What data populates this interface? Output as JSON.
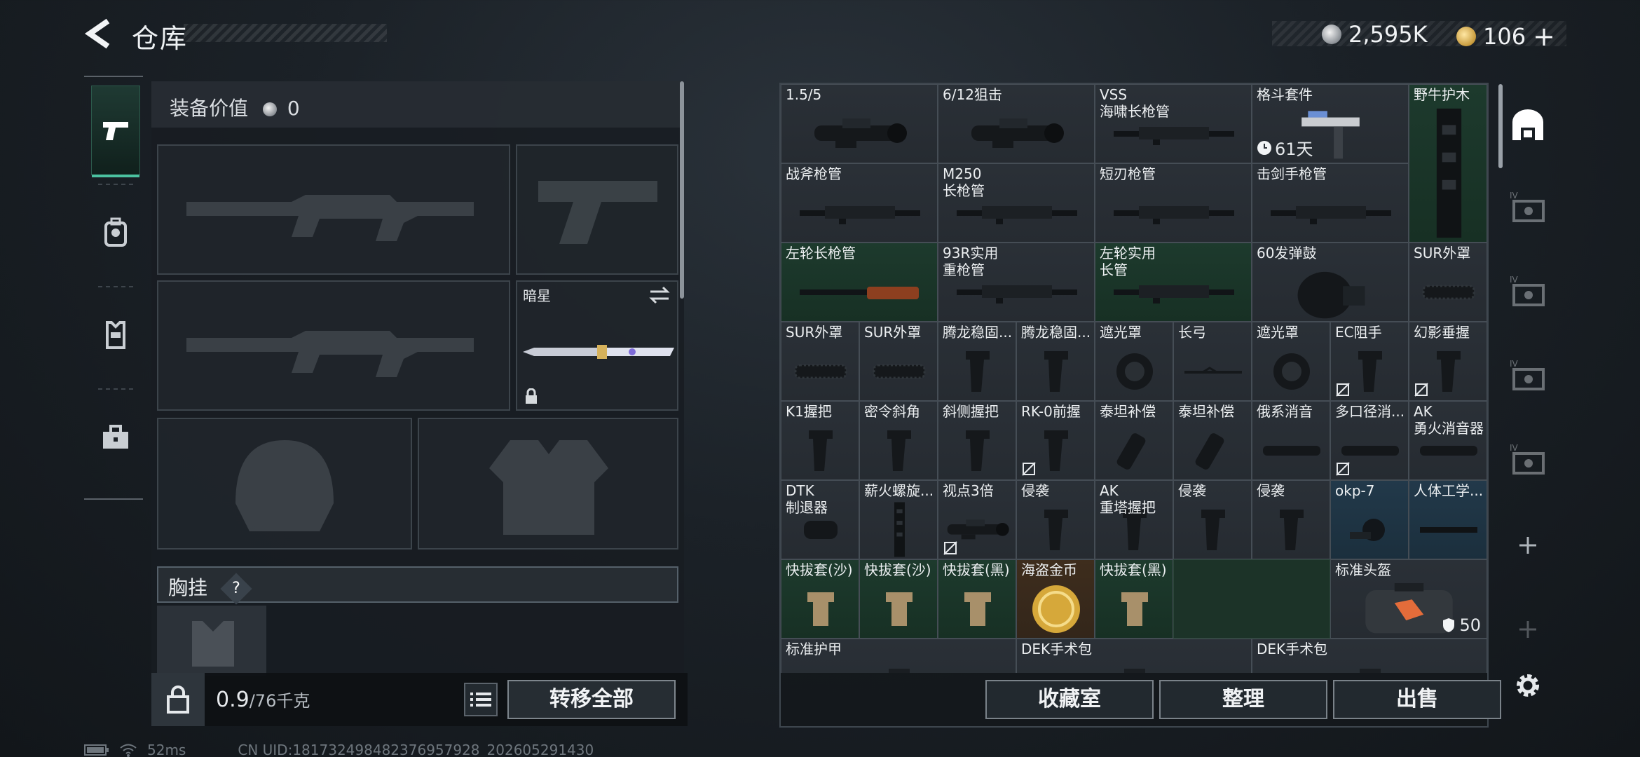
{
  "header": {
    "title": "仓库",
    "silver_amount": "2,595K",
    "gold_amount": "106",
    "gold_add": "+"
  },
  "rail": {
    "items": [
      "weapon-pistol",
      "backpack",
      "vest",
      "toolbox"
    ]
  },
  "loadout": {
    "value_label": "装备价值",
    "value_amount": "0",
    "knife_name": "暗星",
    "vest_label": "胸挂",
    "help_mark": "?"
  },
  "weight": {
    "current": "0.9",
    "capacity": "/76千克"
  },
  "actions": {
    "transfer_all": "转移全部",
    "collection": "收藏室",
    "organize": "整理",
    "sell": "出售"
  },
  "storage_items": [
    {
      "name": "1.5/5",
      "col": 0,
      "row": 0,
      "w": 2,
      "color": "gray",
      "icon": "scope-icon"
    },
    {
      "name": "6/12狙击",
      "col": 2,
      "row": 0,
      "w": 2,
      "color": "gray",
      "icon": "scope-icon"
    },
    {
      "name": "VSS\n海啸长枪管",
      "col": 4,
      "row": 0,
      "w": 2,
      "color": "gray",
      "icon": "barrel-icon"
    },
    {
      "name": "格斗套件",
      "col": 6,
      "row": 0,
      "w": 2,
      "color": "gray",
      "icon": "kit-icon",
      "timer": "61天"
    },
    {
      "name": "野牛护木",
      "col": 8,
      "row": 0,
      "w": 1,
      "h": 2,
      "color": "green",
      "icon": "handguard-icon"
    },
    {
      "name": "战斧枪管",
      "col": 0,
      "row": 1,
      "w": 2,
      "color": "gray",
      "icon": "barrel-icon"
    },
    {
      "name": "M250\n长枪管",
      "col": 2,
      "row": 1,
      "w": 2,
      "color": "gray",
      "icon": "barrel-icon"
    },
    {
      "name": "短刃枪管",
      "col": 4,
      "row": 1,
      "w": 2,
      "color": "gray",
      "icon": "barrel-icon"
    },
    {
      "name": "击剑手枪管",
      "col": 6,
      "row": 1,
      "w": 2,
      "color": "gray",
      "icon": "barrel-icon"
    },
    {
      "name": "左轮长枪管",
      "col": 0,
      "row": 2,
      "w": 2,
      "color": "green",
      "icon": "rifle-barrel-icon"
    },
    {
      "name": "93R实用\n重枪管",
      "col": 2,
      "row": 2,
      "w": 2,
      "color": "gray",
      "icon": "barrel-icon"
    },
    {
      "name": "左轮实用\n长管",
      "col": 4,
      "row": 2,
      "w": 2,
      "color": "green",
      "icon": "barrel-icon"
    },
    {
      "name": "60发弹鼓",
      "col": 6,
      "row": 2,
      "w": 2,
      "color": "gray",
      "icon": "drum-mag-icon"
    },
    {
      "name": "SUR外罩",
      "col": 8,
      "row": 2,
      "w": 1,
      "color": "gray",
      "icon": "shroud-icon"
    },
    {
      "name": "SUR外罩",
      "col": 0,
      "row": 3,
      "w": 1,
      "color": "gray",
      "icon": "shroud-icon"
    },
    {
      "name": "SUR外罩",
      "col": 1,
      "row": 3,
      "w": 1,
      "color": "gray",
      "icon": "shroud-icon"
    },
    {
      "name": "腾龙稳固...",
      "col": 2,
      "row": 3,
      "w": 1,
      "color": "gray",
      "icon": "grip-icon"
    },
    {
      "name": "腾龙稳固...",
      "col": 3,
      "row": 3,
      "w": 1,
      "color": "gray",
      "icon": "grip-icon"
    },
    {
      "name": "遮光罩",
      "col": 4,
      "row": 3,
      "w": 1,
      "color": "gray",
      "icon": "hood-icon"
    },
    {
      "name": "长弓",
      "col": 5,
      "row": 3,
      "w": 1,
      "color": "gray",
      "icon": "bow-icon"
    },
    {
      "name": "遮光罩",
      "col": 6,
      "row": 3,
      "w": 1,
      "color": "gray",
      "icon": "hood-icon"
    },
    {
      "name": "EC阻手",
      "col": 7,
      "row": 3,
      "w": 1,
      "color": "gray",
      "icon": "grip-icon",
      "flag": true
    },
    {
      "name": "幻影垂握",
      "col": 8,
      "row": 3,
      "w": 1,
      "color": "gray",
      "icon": "grip-icon",
      "flag": true
    },
    {
      "name": "K1握把",
      "col": 0,
      "row": 4,
      "w": 1,
      "color": "gray",
      "icon": "grip-icon"
    },
    {
      "name": "密令斜角",
      "col": 1,
      "row": 4,
      "w": 1,
      "color": "gray",
      "icon": "grip-icon"
    },
    {
      "name": "斜侧握把",
      "col": 2,
      "row": 4,
      "w": 1,
      "color": "gray",
      "icon": "grip-icon"
    },
    {
      "name": "RK-0前握",
      "col": 3,
      "row": 4,
      "w": 1,
      "color": "gray",
      "icon": "grip-icon",
      "flag": true
    },
    {
      "name": "泰坦补偿",
      "col": 4,
      "row": 4,
      "w": 1,
      "color": "gray",
      "icon": "comp-icon"
    },
    {
      "name": "泰坦补偿",
      "col": 5,
      "row": 4,
      "w": 1,
      "color": "gray",
      "icon": "comp-icon"
    },
    {
      "name": "俄系消音",
      "col": 6,
      "row": 4,
      "w": 1,
      "color": "gray",
      "icon": "suppressor-icon"
    },
    {
      "name": "多口径消...",
      "col": 7,
      "row": 4,
      "w": 1,
      "color": "gray",
      "icon": "suppressor-icon",
      "flag": true
    },
    {
      "name": "AK\n勇火消音器",
      "col": 8,
      "row": 4,
      "w": 1,
      "color": "gray",
      "icon": "suppressor-icon"
    },
    {
      "name": "DTK\n制退器",
      "col": 0,
      "row": 5,
      "w": 1,
      "color": "gray",
      "icon": "brake-icon"
    },
    {
      "name": "薪火螺旋...",
      "col": 1,
      "row": 5,
      "w": 1,
      "color": "gray",
      "icon": "handguard-icon"
    },
    {
      "name": "视点3倍",
      "col": 2,
      "row": 5,
      "w": 1,
      "color": "gray",
      "icon": "scope-icon",
      "flag": true
    },
    {
      "name": "侵袭",
      "col": 3,
      "row": 5,
      "w": 1,
      "color": "gray",
      "icon": "grip-icon"
    },
    {
      "name": "AK\n重塔握把",
      "col": 4,
      "row": 5,
      "w": 1,
      "color": "gray",
      "icon": "grip-icon"
    },
    {
      "name": "侵袭",
      "col": 5,
      "row": 5,
      "w": 1,
      "color": "gray",
      "icon": "grip-icon"
    },
    {
      "name": "侵袭",
      "col": 6,
      "row": 5,
      "w": 1,
      "color": "gray",
      "icon": "grip-icon"
    },
    {
      "name": "okp-7",
      "col": 7,
      "row": 5,
      "w": 1,
      "color": "blue",
      "icon": "sight-icon"
    },
    {
      "name": "人体工学...",
      "col": 8,
      "row": 5,
      "w": 1,
      "color": "blue",
      "icon": "rail-icon"
    },
    {
      "name": "快拔套(沙)",
      "col": 0,
      "row": 6,
      "w": 1,
      "color": "green",
      "icon": "mag-sleeve-icon"
    },
    {
      "name": "快拔套(沙)",
      "col": 1,
      "row": 6,
      "w": 1,
      "color": "green",
      "icon": "mag-sleeve-icon"
    },
    {
      "name": "快拔套(黑)",
      "col": 2,
      "row": 6,
      "w": 1,
      "color": "green",
      "icon": "mag-sleeve-icon"
    },
    {
      "name": "海盗金币",
      "col": 3,
      "row": 6,
      "w": 1,
      "color": "orange",
      "icon": "gold-coin-icon"
    },
    {
      "name": "快拔套(黑)",
      "col": 4,
      "row": 6,
      "w": 1,
      "color": "green",
      "icon": "mag-sleeve-icon"
    },
    {
      "name": "",
      "col": 5,
      "row": 6,
      "w": 2,
      "color": "empty-green",
      "icon": ""
    },
    {
      "name": "标准头盔",
      "col": 7,
      "row": 6,
      "w": 2,
      "color": "gray",
      "icon": "bag-icon",
      "count": "50"
    },
    {
      "name": "标准护甲",
      "col": 0,
      "row": 7,
      "w": 3,
      "color": "gray",
      "icon": "case-icon"
    },
    {
      "name": "DEK手术包",
      "col": 3,
      "row": 7,
      "w": 3,
      "color": "gray",
      "icon": "case-icon"
    },
    {
      "name": "DEK手术包",
      "col": 6,
      "row": 7,
      "w": 3,
      "color": "gray",
      "icon": "case-icon"
    }
  ],
  "status": {
    "ping": "52ms",
    "uid": "CN UID:18173249848237695792​8_202605291430"
  }
}
